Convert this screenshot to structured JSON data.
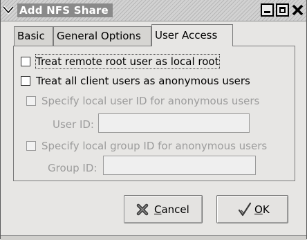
{
  "window": {
    "title": "Add NFS Share",
    "menu_icon": "chevron-down-icon",
    "minimize_icon": "minimize-icon",
    "maximize_icon": "maximize-icon",
    "close_icon": "close-icon"
  },
  "tabs": [
    {
      "label": "Basic",
      "active": false
    },
    {
      "label": "General Options",
      "active": false
    },
    {
      "label": "User Access",
      "active": true
    }
  ],
  "options": {
    "root_as_local_root": {
      "label": "Treat remote root user as local root",
      "checked": false,
      "enabled": true
    },
    "all_anonymous": {
      "label": "Treat all client users as anonymous users",
      "checked": false,
      "enabled": true
    },
    "specify_uid": {
      "label": "Specify local user ID for anonymous users",
      "checked": false,
      "enabled": false
    },
    "user_id": {
      "label": "User ID:",
      "value": "",
      "enabled": false
    },
    "specify_gid": {
      "label": "Specify local group ID for anonymous users",
      "checked": false,
      "enabled": false
    },
    "group_id": {
      "label": "Group ID:",
      "value": "",
      "enabled": false
    }
  },
  "buttons": {
    "cancel": {
      "label_pre": "",
      "label_mnemonic": "C",
      "label_post": "ancel",
      "icon": "cancel-x-icon"
    },
    "ok": {
      "label_pre": "",
      "label_mnemonic": "O",
      "label_post": "K",
      "icon": "checkmark-icon"
    }
  },
  "colors": {
    "background": "#e7e6e4",
    "disabled_text": "#9c9c9c",
    "title_text": "#ffffff"
  }
}
